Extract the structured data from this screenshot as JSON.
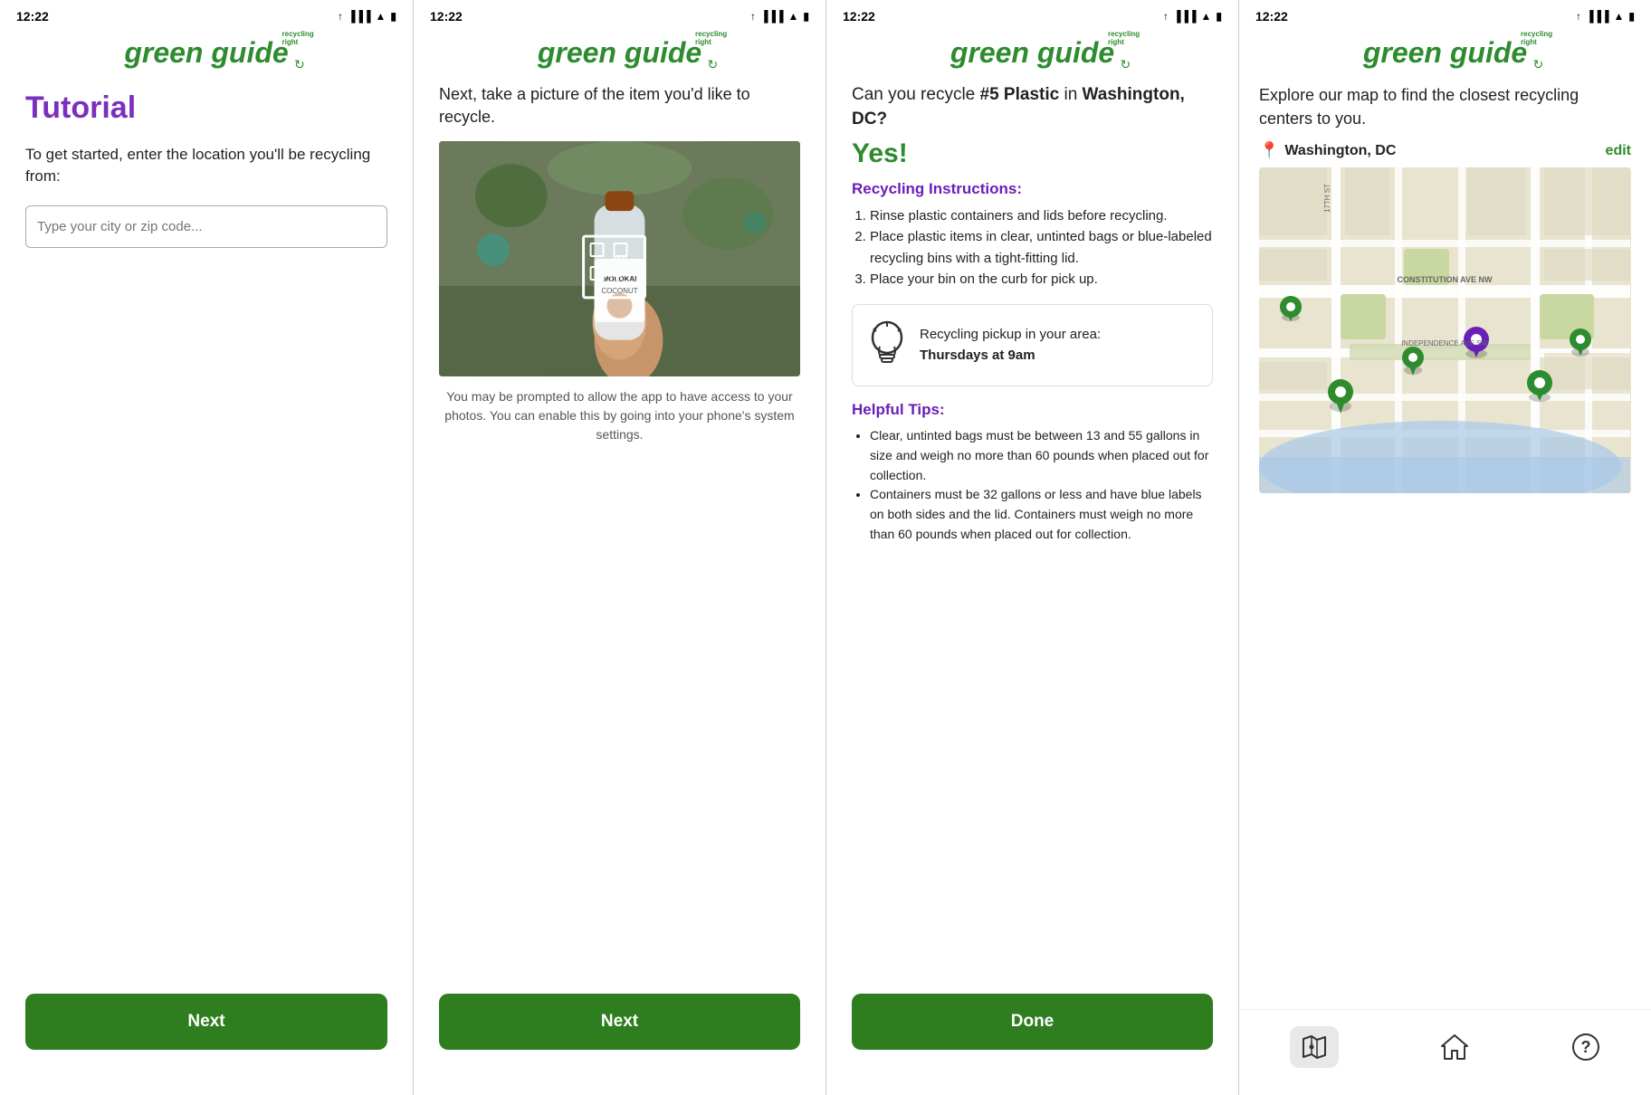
{
  "screens": [
    {
      "id": "tutorial",
      "statusBar": {
        "time": "12:22",
        "arrow": "↑"
      },
      "logo": {
        "text": "green guide",
        "subtext": "recycling right"
      },
      "title": "Tutorial",
      "description": "To get started, enter the location you'll be recycling from:",
      "input": {
        "placeholder": "Type your city or zip code..."
      },
      "button": {
        "label": "Next"
      }
    },
    {
      "id": "camera",
      "statusBar": {
        "time": "12:22",
        "arrow": "↑"
      },
      "logo": {
        "text": "green guide",
        "subtext": "recycling right"
      },
      "description": "Next, take a picture of the item you'd like to recycle.",
      "caption": "You may be prompted to allow the app to have access to your photos. You can enable this by going into your phone's system settings.",
      "button": {
        "label": "Next"
      }
    },
    {
      "id": "results",
      "statusBar": {
        "time": "12:22",
        "arrow": "↑"
      },
      "logo": {
        "text": "green guide",
        "subtext": "recycling right"
      },
      "question": "Can you recycle #5 Plastic in Washington, DC?",
      "answer": "Yes!",
      "instructionsTitle": "Recycling Instructions:",
      "instructions": [
        "Rinse plastic containers and lids before recycling.",
        "Place plastic items in clear, untinted bags or blue-labeled recycling bins with a tight-fitting lid.",
        "Place your bin on the curb for pick up."
      ],
      "pickup": {
        "icon": "💡",
        "label": "Recycling pickup in your area:",
        "value": "Thursdays at 9am"
      },
      "helpfulTitle": "Helpful Tips:",
      "tips": [
        "Clear, untinted bags must be between 13 and 55 gallons in size and weigh no more than 60 pounds when placed out for collection.",
        "Containers must be 32 gallons or less and have blue labels on both sides and the lid. Containers must weigh no more than 60 pounds when placed out for collection."
      ],
      "button": {
        "label": "Done"
      }
    },
    {
      "id": "map",
      "statusBar": {
        "time": "12:22",
        "arrow": "↑"
      },
      "logo": {
        "text": "green guide",
        "subtext": "recycling right"
      },
      "description": "Explore our map to find the closest recycling centers to you.",
      "location": "Washington, DC",
      "editLabel": "edit",
      "nav": [
        {
          "icon": "map",
          "label": "map-nav-icon"
        },
        {
          "icon": "home",
          "label": "home-nav-icon"
        },
        {
          "icon": "help",
          "label": "help-nav-icon"
        }
      ]
    }
  ],
  "colors": {
    "green": "#2e8b2e",
    "darkGreen": "#2e7d1e",
    "purple": "#7b2fbe",
    "purpleLight": "#6a1fb8",
    "gray": "#d8d8d8"
  }
}
